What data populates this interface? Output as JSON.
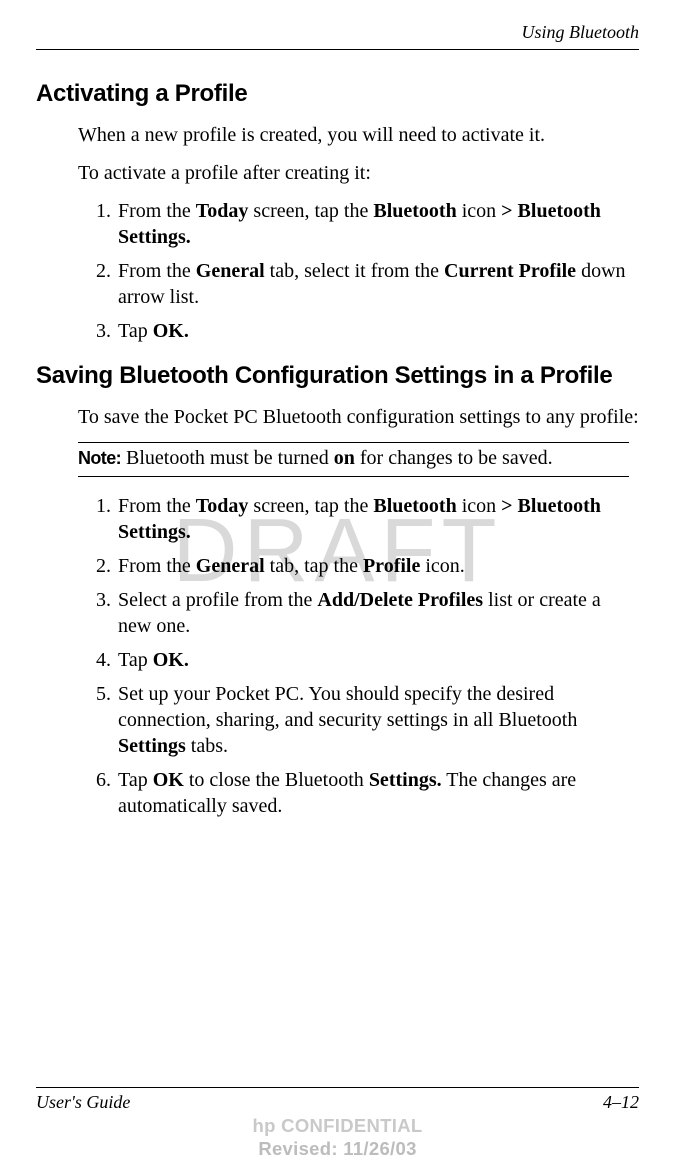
{
  "header": {
    "chapter": "Using Bluetooth"
  },
  "watermark": "DRAFT",
  "section1": {
    "title": "Activating a Profile",
    "intro1": "When a new profile is created, you will need to activate it.",
    "intro2": "To activate a profile after creating it:",
    "steps": [
      {
        "num": "1.",
        "pre": "From the ",
        "b1": "Today",
        "mid1": " screen, tap the ",
        "b2": "Bluetooth",
        "mid2": " icon ",
        "b3": "> Bluetooth Settings.",
        "post": ""
      },
      {
        "num": "2.",
        "pre": "From the ",
        "b1": "General",
        "mid1": " tab, select it from the ",
        "b2": "Current Profile",
        "mid2": " down arrow list.",
        "b3": "",
        "post": ""
      },
      {
        "num": "3.",
        "pre": "Tap ",
        "b1": "OK.",
        "mid1": "",
        "b2": "",
        "mid2": "",
        "b3": "",
        "post": ""
      }
    ]
  },
  "section2": {
    "title": "Saving Bluetooth Configuration Settings in a Profile",
    "intro1": "To save the Pocket PC Bluetooth configuration settings to any profile:",
    "note": {
      "label": "Note:",
      "text_pre": " Bluetooth must be turned ",
      "text_b": "on",
      "text_post": " for changes to be saved."
    },
    "steps": [
      {
        "num": "1.",
        "segs": [
          {
            "t": "From the "
          },
          {
            "t": "Today",
            "b": 1
          },
          {
            "t": " screen, tap the "
          },
          {
            "t": "Bluetooth",
            "b": 1
          },
          {
            "t": " icon "
          },
          {
            "t": "> Bluetooth Settings.",
            "b": 1
          }
        ]
      },
      {
        "num": "2.",
        "segs": [
          {
            "t": "From the "
          },
          {
            "t": "General",
            "b": 1
          },
          {
            "t": " tab, tap the "
          },
          {
            "t": "Profile",
            "b": 1
          },
          {
            "t": " icon."
          }
        ]
      },
      {
        "num": "3.",
        "segs": [
          {
            "t": "Select a profile from the "
          },
          {
            "t": "Add/Delete Profiles",
            "b": 1
          },
          {
            "t": " list or create a new one."
          }
        ]
      },
      {
        "num": "4.",
        "segs": [
          {
            "t": "Tap "
          },
          {
            "t": "OK.",
            "b": 1
          }
        ]
      },
      {
        "num": "5.",
        "segs": [
          {
            "t": "Set up your Pocket PC. You should specify the desired connection, sharing, and security settings in all Bluetooth "
          },
          {
            "t": "Settings",
            "b": 1
          },
          {
            "t": " tabs."
          }
        ]
      },
      {
        "num": "6.",
        "segs": [
          {
            "t": "Tap "
          },
          {
            "t": "OK",
            "b": 1
          },
          {
            "t": " to close the Bluetooth "
          },
          {
            "t": "Settings.",
            "b": 1
          },
          {
            "t": " The changes are automatically saved."
          }
        ]
      }
    ]
  },
  "footer": {
    "left": "User's Guide",
    "right": "4–12"
  },
  "confidential": {
    "line1": "hp CONFIDENTIAL",
    "line2": "Revised: 11/26/03"
  }
}
